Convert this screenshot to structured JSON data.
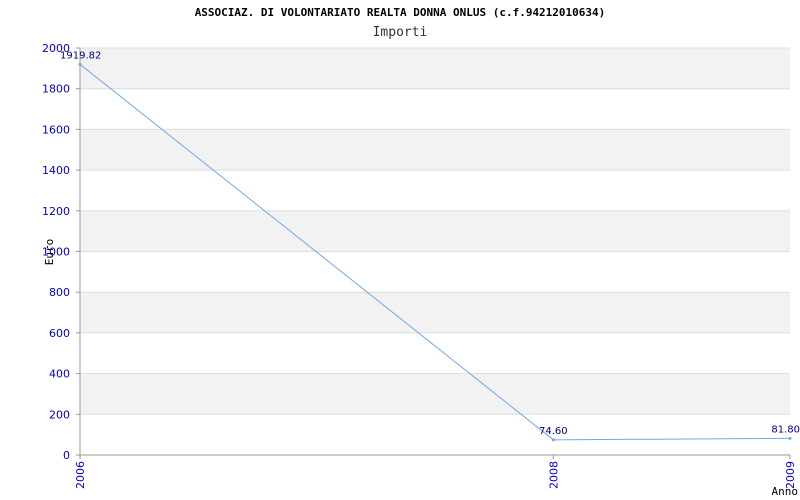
{
  "chart_data": {
    "type": "line",
    "title": "ASSOCIAZ. DI VOLONTARIATO REALTA DONNA ONLUS (c.f.94212010634)",
    "subtitle": "Importi",
    "xlabel": "Anno",
    "ylabel": "Euro",
    "x": [
      "2006",
      "2008",
      "2009"
    ],
    "series": [
      {
        "values": [
          1919.82,
          74.6,
          81.8
        ],
        "labels": [
          "1919.82",
          "74.60",
          "81.80"
        ]
      }
    ],
    "ylim": [
      0,
      2000
    ],
    "yticks": [
      0,
      200,
      400,
      600,
      800,
      1000,
      1200,
      1400,
      1600,
      1800,
      2000
    ],
    "grid": true,
    "colors": {
      "line": "#6fa8e8",
      "band": "#f2f2f2",
      "axis": "#999999",
      "tick_text": "#0000cc",
      "data_label": "#000080"
    }
  }
}
